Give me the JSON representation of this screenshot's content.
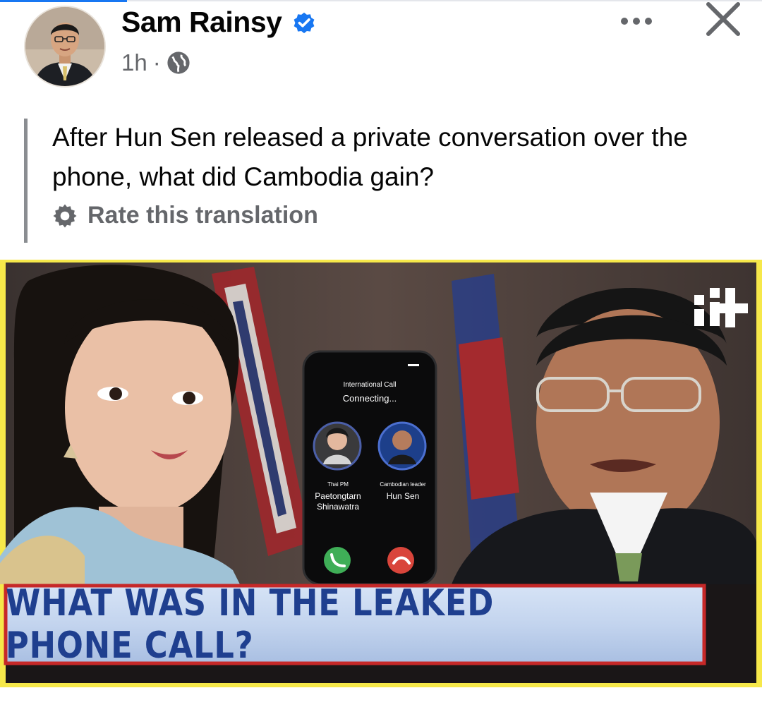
{
  "post": {
    "author": "Sam Rainsy",
    "time": "1h",
    "separator": "·",
    "text": "After Hun Sen released a private conversation over the phone, what did Cambodia gain?",
    "rate_label": "Rate this translation"
  },
  "media": {
    "call_type": "International Call",
    "status": "Connecting...",
    "caller_left": {
      "title": "Thai PM",
      "name_line1": "Paetongtarn",
      "name_line2": "Shinawatra"
    },
    "caller_right": {
      "title": "Cambodian leader",
      "name_line1": "Hun Sen"
    },
    "headline": "WHAT WAS IN THE LEAKED PHONE CALL?"
  },
  "icons": {
    "verified": "verified-badge-icon",
    "audience": "globe-icon",
    "more": "more-options-icon",
    "close": "close-icon",
    "rate": "gear-icon"
  },
  "colors": {
    "brand_blue": "#1877f2",
    "secondary_text": "#65676b",
    "media_border": "#f6e84a",
    "headline_text": "#1f3f8f",
    "headline_border": "#c62828"
  }
}
